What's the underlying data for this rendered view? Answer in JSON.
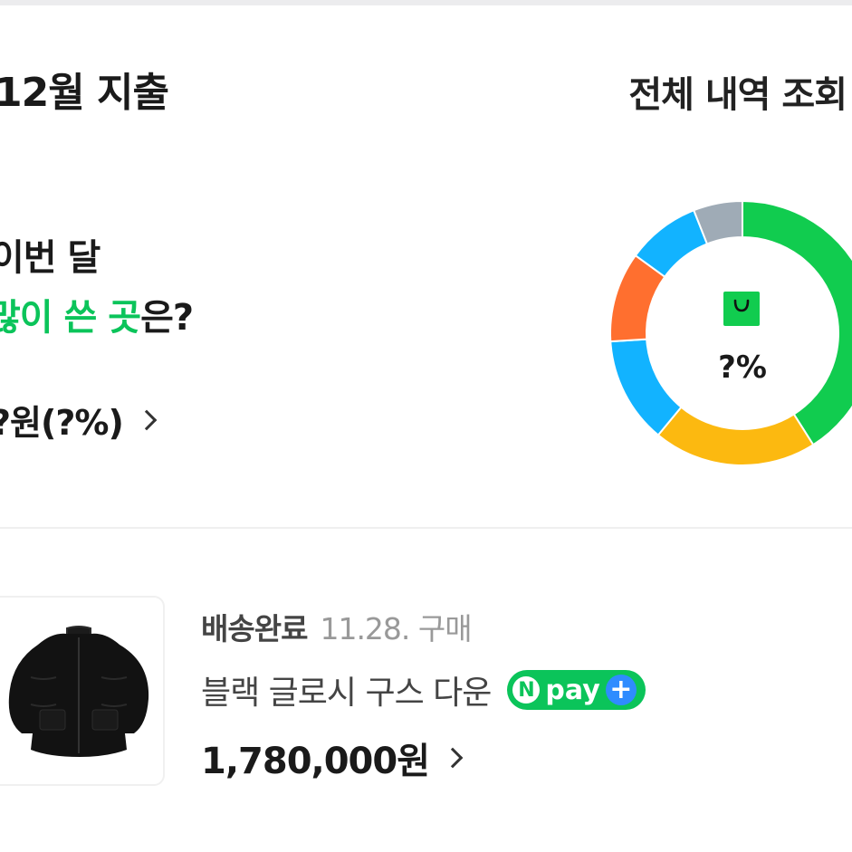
{
  "header": {
    "month_title": "12월 지출",
    "all_history_label": "전체 내역 조회"
  },
  "top_spend": {
    "line1": "이번 달",
    "line2_highlight": "많이 쓴 곳",
    "line2_suffix": "은?",
    "amount_text": "?원(?%)"
  },
  "donut": {
    "center_icon": "shopping-bag-icon",
    "center_percent": "?%",
    "segments": [
      {
        "color": "#11cc4f",
        "fraction": 0.41
      },
      {
        "color": "#fcb910",
        "fraction": 0.2
      },
      {
        "color": "#12b3ff",
        "fraction": 0.13
      },
      {
        "color": "#ff6f2f",
        "fraction": 0.11
      },
      {
        "color": "#12b3ff",
        "fraction": 0.09
      },
      {
        "color": "#9fabb6",
        "fraction": 0.06
      }
    ]
  },
  "order": {
    "status": "배송완료",
    "date": "11.28. 구매",
    "product_name": "블랙 글로시 구스 다운",
    "badge": {
      "n": "N",
      "text": "pay",
      "plus": "+"
    },
    "price": "1,780,000원"
  },
  "colors": {
    "accent_green": "#0bc45a",
    "npay_blue": "#2f8cff"
  }
}
